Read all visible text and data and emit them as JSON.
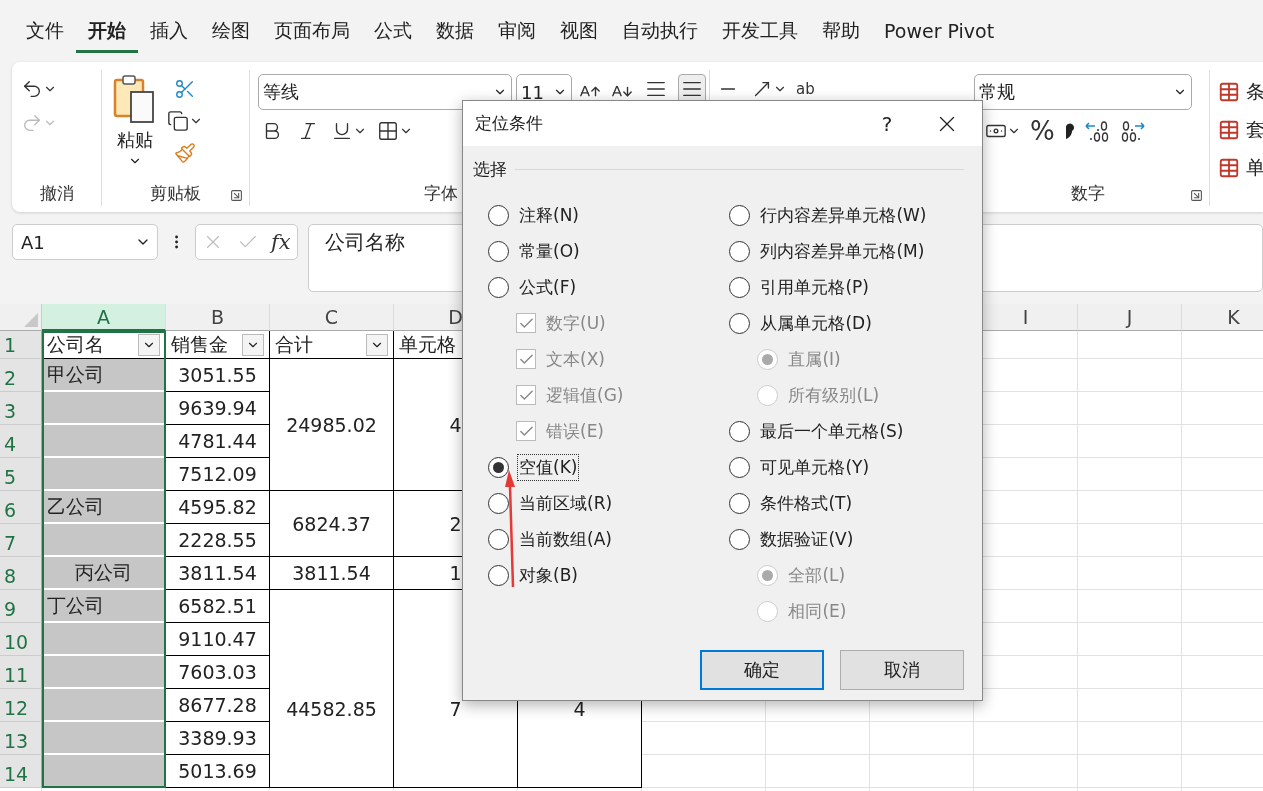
{
  "menu_tabs": [
    {
      "label": "文件",
      "selected": false
    },
    {
      "label": "开始",
      "selected": true
    },
    {
      "label": "插入",
      "selected": false
    },
    {
      "label": "绘图",
      "selected": false
    },
    {
      "label": "页面布局",
      "selected": false
    },
    {
      "label": "公式",
      "selected": false
    },
    {
      "label": "数据",
      "selected": false
    },
    {
      "label": "审阅",
      "selected": false
    },
    {
      "label": "视图",
      "selected": false
    },
    {
      "label": "自动执行",
      "selected": false
    },
    {
      "label": "开发工具",
      "selected": false
    },
    {
      "label": "帮助",
      "selected": false
    },
    {
      "label": "Power Pivot",
      "selected": false
    }
  ],
  "ribbon": {
    "undo_group": {
      "label": "撤消",
      "redo_disabled": true
    },
    "clipboard_group": {
      "paste": "粘贴",
      "label": "剪贴板"
    },
    "font_group": {
      "font_name": "等线",
      "font_size": "11",
      "label": "字体"
    },
    "alignment_group": {
      "wrap_label": "ab"
    },
    "number_group": {
      "format": "常规",
      "percent": "%",
      "label": "数字"
    },
    "styles_group": {
      "items": [
        "条",
        "套",
        "单"
      ]
    }
  },
  "formula_bar": {
    "name_box": "A1",
    "fx": "fx",
    "formula": "公司名称"
  },
  "grid": {
    "columns": [
      {
        "label": "A",
        "selected": true,
        "cells": [
          {
            "text": "公司名",
            "filter": true,
            "selected": false
          },
          {
            "text": "甲公司",
            "kind": "left",
            "selected": true
          },
          {
            "selected": true
          },
          {
            "selected": true
          },
          {
            "selected": true
          },
          {
            "text": "乙公司",
            "kind": "left",
            "selected": true
          },
          {
            "selected": true
          },
          {
            "text": "丙公司",
            "selected": true
          },
          {
            "text": "丁公司",
            "kind": "left",
            "selected": true
          },
          {
            "selected": true
          },
          {
            "selected": true
          },
          {
            "selected": true
          },
          {
            "selected": true
          },
          {
            "selected": true
          }
        ]
      },
      {
        "label": "B",
        "selected": false,
        "cells": [
          {
            "text": "销售金",
            "filter": true,
            "kind": "left",
            "selected": false
          },
          {
            "text": "3051.55",
            "selected": false
          },
          {
            "text": "9639.94",
            "selected": false
          },
          {
            "text": "4781.44",
            "selected": false
          },
          {
            "text": "7512.09",
            "selected": false
          },
          {
            "text": "4595.82",
            "selected": false
          },
          {
            "text": "2228.55",
            "selected": false
          },
          {
            "text": "3811.54",
            "selected": false
          },
          {
            "text": "6582.51",
            "selected": false
          },
          {
            "text": "9110.47",
            "selected": false
          },
          {
            "text": "7603.03",
            "selected": false
          },
          {
            "text": "8677.28",
            "selected": false
          },
          {
            "text": "3389.93",
            "selected": false
          },
          {
            "text": "5013.69",
            "selected": false
          }
        ]
      },
      {
        "label": "C",
        "selected": false,
        "cells": [
          {
            "text": "合计",
            "filter": true,
            "selected": false
          },
          {
            "text": "24985.02",
            "selected": false
          },
          {
            "kind": "merged"
          },
          {
            "kind": "merged"
          },
          {
            "kind": "merged"
          },
          {
            "text": "6824.37",
            "selected": false
          },
          {
            "kind": "merged"
          },
          {
            "text": "3811.54",
            "selected": false
          },
          {
            "text": "44582.85",
            "selected": false
          },
          {
            "kind": "merged"
          },
          {
            "kind": "merged"
          },
          {
            "kind": "merged"
          },
          {
            "kind": "merged"
          },
          {
            "kind": "merged"
          }
        ]
      },
      {
        "label": "D",
        "selected": false,
        "cells": [
          {
            "text": "单元格",
            "kind": "left",
            "selected": false
          },
          {
            "text": "4",
            "selected": false
          },
          {
            "kind": "merged"
          },
          {
            "kind": "merged"
          },
          {
            "kind": "merged"
          },
          {
            "text": "2",
            "selected": false
          },
          {
            "kind": "merged"
          },
          {
            "text": "1",
            "selected": false
          },
          {
            "text": "7",
            "selected": false
          },
          {
            "kind": "merged"
          },
          {
            "kind": "merged"
          },
          {
            "kind": "merged"
          },
          {
            "kind": "merged"
          },
          {
            "kind": "merged"
          }
        ]
      },
      {
        "cells": [
          null,
          null,
          null,
          null,
          null,
          null,
          null,
          null,
          {
            "text": "4",
            "selected": false
          },
          {
            "kind": "merged"
          },
          {
            "kind": "merged"
          },
          {
            "kind": "merged"
          },
          {
            "kind": "merged"
          },
          {
            "kind": "merged"
          }
        ]
      },
      {},
      {},
      {},
      {
        "label": "I",
        "selected": false
      },
      {
        "label": "J",
        "selected": false
      },
      {
        "label": "K",
        "selected": false
      }
    ],
    "rows": [
      {
        "label": "1",
        "selected": true
      },
      {
        "label": "2",
        "selected": true
      },
      {
        "label": "3",
        "selected": true
      },
      {
        "label": "4",
        "selected": true
      },
      {
        "label": "5",
        "selected": true
      },
      {
        "label": "6",
        "selected": true
      },
      {
        "label": "7",
        "selected": true
      },
      {
        "label": "8",
        "selected": true
      },
      {
        "label": "9",
        "selected": true
      },
      {
        "label": "10",
        "selected": true
      },
      {
        "label": "11",
        "selected": true
      },
      {
        "label": "12",
        "selected": true
      },
      {
        "label": "13",
        "selected": true
      },
      {
        "label": "14",
        "selected": true
      }
    ]
  },
  "dialog": {
    "title": "定位条件",
    "help": "?",
    "group_label": "选择",
    "left_options": [
      {
        "kind": "radio",
        "label": "注释(N)",
        "selected": false,
        "disabled": false
      },
      {
        "kind": "radio",
        "label": "常量(O)",
        "selected": false,
        "disabled": false
      },
      {
        "kind": "radio",
        "label": "公式(F)",
        "selected": false,
        "disabled": false,
        "children": [
          {
            "kind": "checkbox",
            "label": "数字(U)",
            "checked": true,
            "disabled": true
          },
          {
            "kind": "checkbox",
            "label": "文本(X)",
            "checked": true,
            "disabled": true
          },
          {
            "kind": "checkbox",
            "label": "逻辑值(G)",
            "checked": true,
            "disabled": true
          },
          {
            "kind": "checkbox",
            "label": "错误(E)",
            "checked": true,
            "disabled": true
          }
        ]
      },
      {
        "kind": "radio",
        "label": "空值(K)",
        "selected": true,
        "disabled": false,
        "focused": true
      },
      {
        "kind": "radio",
        "label": "当前区域(R)",
        "selected": false,
        "disabled": false
      },
      {
        "kind": "radio",
        "label": "当前数组(A)",
        "selected": false,
        "disabled": false
      },
      {
        "kind": "radio",
        "label": "对象(B)",
        "selected": false,
        "disabled": false
      }
    ],
    "right_options": [
      {
        "kind": "radio",
        "label": "行内容差异单元格(W)",
        "selected": false,
        "disabled": false
      },
      {
        "kind": "radio",
        "label": "列内容差异单元格(M)",
        "selected": false,
        "disabled": false
      },
      {
        "kind": "radio",
        "label": "引用单元格(P)",
        "selected": false,
        "disabled": false
      },
      {
        "kind": "radio",
        "label": "从属单元格(D)",
        "selected": false,
        "disabled": false,
        "children": [
          {
            "kind": "radio",
            "label": "直属(I)",
            "selected": true,
            "disabled": true
          },
          {
            "kind": "radio",
            "label": "所有级别(L)",
            "selected": false,
            "disabled": true
          }
        ]
      },
      {
        "kind": "radio",
        "label": "最后一个单元格(S)",
        "selected": false,
        "disabled": false
      },
      {
        "kind": "radio",
        "label": "可见单元格(Y)",
        "selected": false,
        "disabled": false
      },
      {
        "kind": "radio",
        "label": "条件格式(T)",
        "selected": false,
        "disabled": false
      },
      {
        "kind": "radio",
        "label": "数据验证(V)",
        "selected": false,
        "disabled": false,
        "children": [
          {
            "kind": "radio",
            "label": "全部(L)",
            "selected": true,
            "disabled": true
          },
          {
            "kind": "radio",
            "label": "相同(E)",
            "selected": false,
            "disabled": true
          }
        ]
      }
    ],
    "buttons": [
      {
        "label": "确定",
        "default": true
      },
      {
        "label": "取消",
        "default": false
      }
    ]
  }
}
